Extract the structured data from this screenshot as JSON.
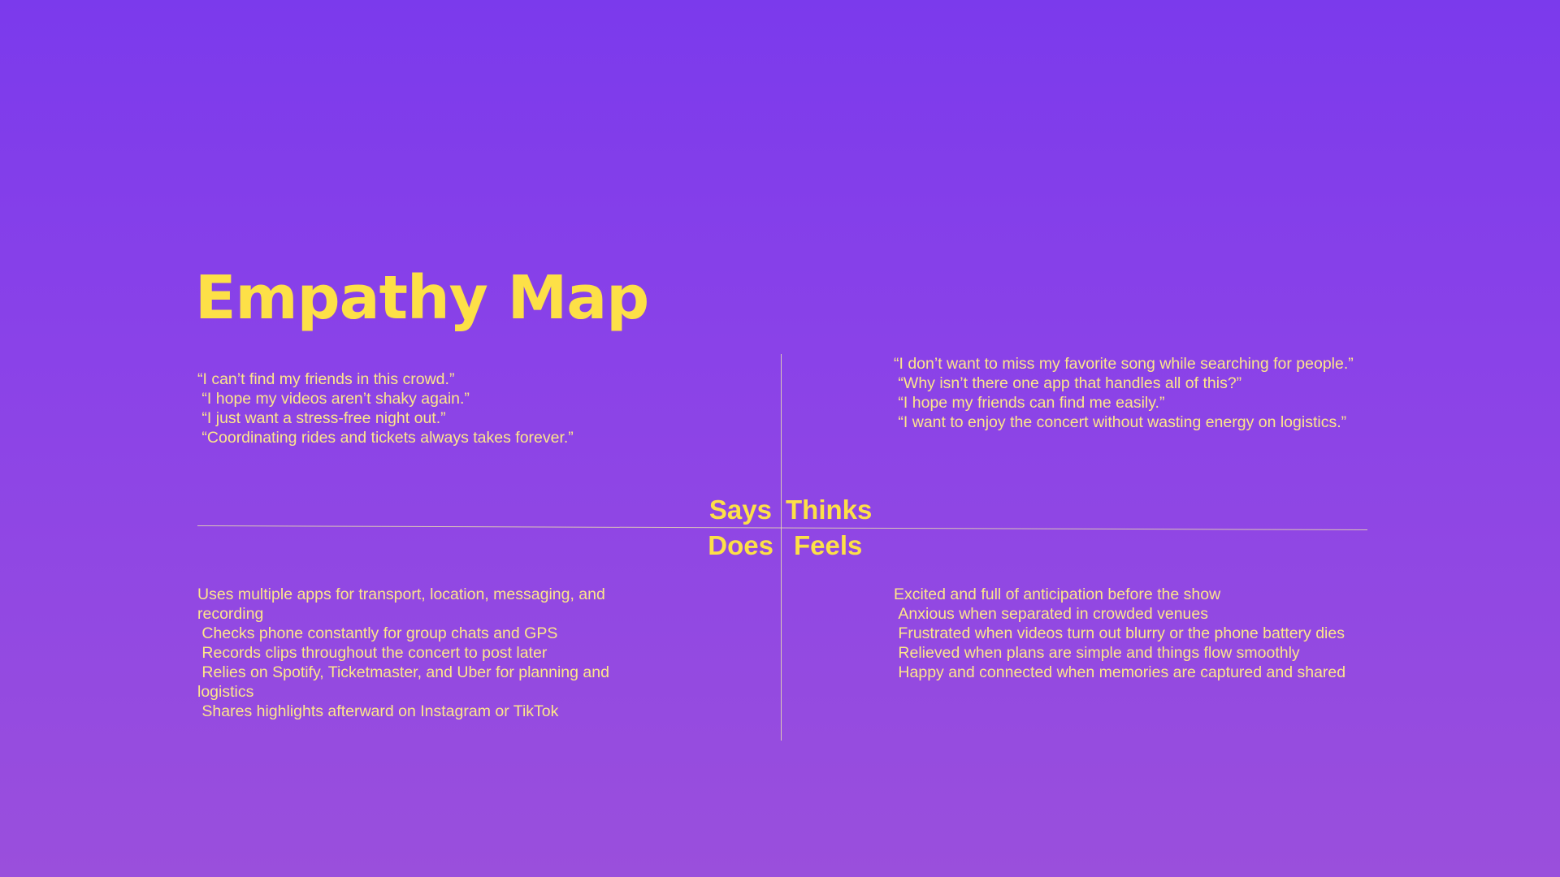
{
  "title": "Empathy Map",
  "labels": {
    "says": "Says",
    "thinks": "Thinks",
    "does": "Does",
    "feels": "Feels"
  },
  "says": [
    "“I can’t find my friends in this crowd.”",
    " “I hope my videos aren’t shaky again.”",
    " “I just want a stress-free night out.”",
    " “Coordinating rides and tickets always takes forever.”"
  ],
  "thinks": [
    "“I don’t want to miss my favorite song while searching for people.”",
    " “Why isn’t there one app that handles all of this?”",
    " “I hope my friends can find me easily.”",
    " “I want to enjoy the concert without wasting energy on logistics.”"
  ],
  "does": [
    "Uses multiple apps for transport, location, messaging, and recording",
    " Checks phone constantly for group chats and GPS",
    " Records clips throughout the concert to post later",
    " Relies on Spotify, Ticketmaster, and Uber for planning and logistics",
    " Shares highlights afterward on Instagram or TikTok"
  ],
  "feels": [
    "Excited and full of anticipation before the show",
    " Anxious when separated in crowded venues",
    " Frustrated when videos turn out blurry or the phone battery dies",
    " Relieved when plans are simple and things flow smoothly",
    " Happy and connected when memories are captured and shared"
  ],
  "colors": {
    "background_top": "#7b3aec",
    "background_bottom": "#9a4fdc",
    "accent": "#fde047",
    "body_text": "#fde68a",
    "divider": "#e9dcb0"
  }
}
